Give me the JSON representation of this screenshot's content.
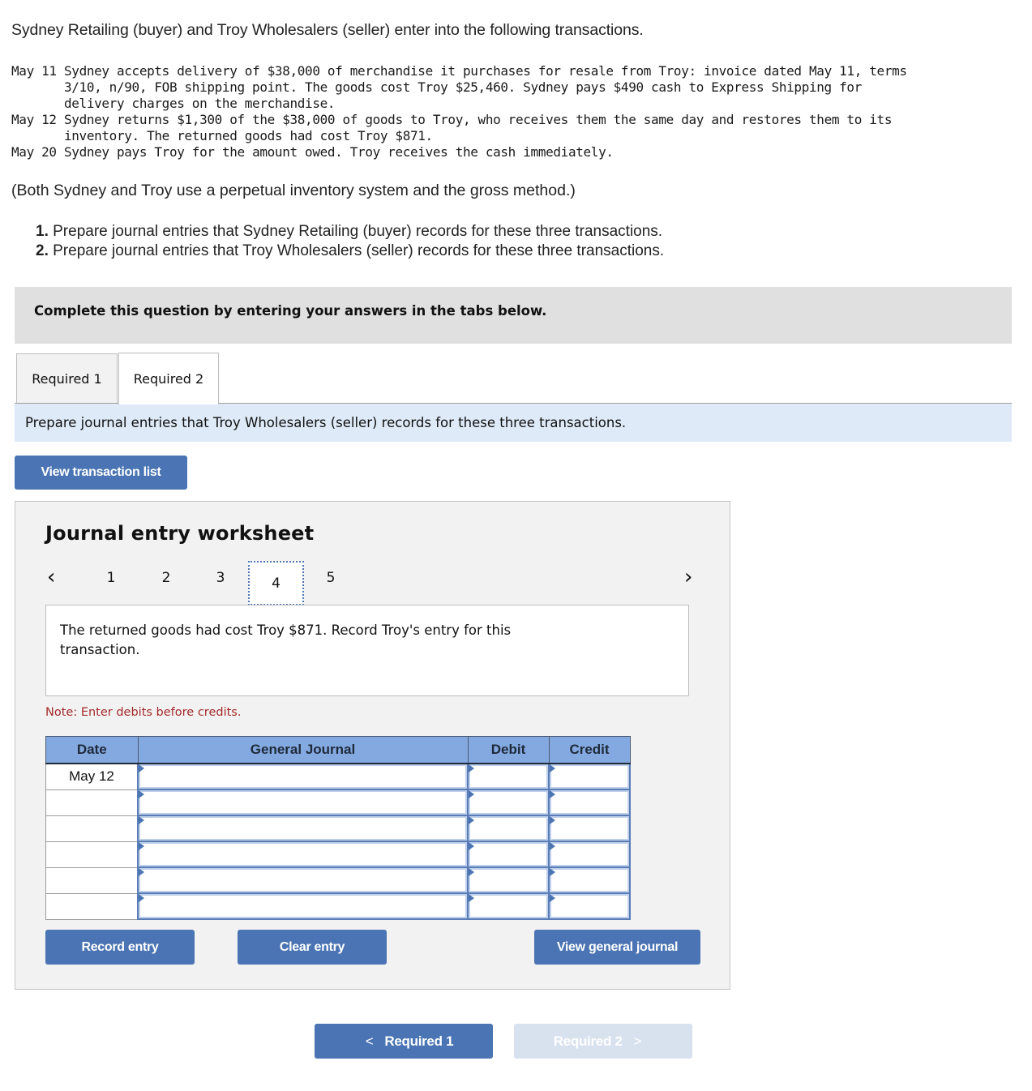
{
  "intro": "Sydney Retailing (buyer) and Troy Wholesalers (seller) enter into the following transactions.",
  "transactions": [
    {
      "date": "May 11",
      "lines": [
        "Sydney accepts delivery of $38,000 of merchandise it purchases for resale from Troy: invoice dated May 11, terms",
        "3/10, n/90, FOB shipping point. The goods cost Troy $25,460. Sydney pays $490 cash to Express Shipping for",
        "delivery charges on the merchandise."
      ]
    },
    {
      "date": "May 12",
      "lines": [
        "Sydney returns $1,300 of the $38,000 of goods to Troy, who receives them the same day and restores them to its",
        "inventory. The returned goods had cost Troy $871."
      ]
    },
    {
      "date": "May 20",
      "lines": [
        "Sydney pays Troy for the amount owed. Troy receives the cash immediately."
      ]
    }
  ],
  "assumption": "(Both Sydney and Troy use a perpetual inventory system and the gross method.)",
  "requirements": [
    {
      "num": "1.",
      "text": " Prepare journal entries that Sydney Retailing (buyer) records for these three transactions."
    },
    {
      "num": "2.",
      "text": " Prepare journal entries that Troy Wholesalers (seller) records for these three transactions."
    }
  ],
  "banner": "Complete this question by entering your answers in the tabs below.",
  "tabs": [
    {
      "label": "Required 1",
      "active": false
    },
    {
      "label": "Required 2",
      "active": true
    }
  ],
  "instruction": "Prepare journal entries that Troy Wholesalers (seller) records for these three transactions.",
  "view_transaction_list": "View transaction list",
  "worksheet": {
    "title": "Journal entry worksheet",
    "pages": [
      "1",
      "2",
      "3",
      "4",
      "5"
    ],
    "active_page": "4",
    "prev_icon": "chevron-left-icon",
    "next_icon": "chevron-right-icon",
    "description": "The returned goods had cost Troy $871. Record Troy's entry for this transaction.",
    "note": "Note: Enter debits before credits.",
    "columns": [
      "Date",
      "General Journal",
      "Debit",
      "Credit"
    ],
    "rows": [
      {
        "date": "May 12",
        "account": "",
        "debit": "",
        "credit": ""
      },
      {
        "date": "",
        "account": "",
        "debit": "",
        "credit": ""
      },
      {
        "date": "",
        "account": "",
        "debit": "",
        "credit": ""
      },
      {
        "date": "",
        "account": "",
        "debit": "",
        "credit": ""
      },
      {
        "date": "",
        "account": "",
        "debit": "",
        "credit": ""
      },
      {
        "date": "",
        "account": "",
        "debit": "",
        "credit": ""
      }
    ],
    "record_entry": "Record entry",
    "clear_entry": "Clear entry",
    "view_general_journal": "View general journal"
  },
  "footer_nav": {
    "prev_label": "Required 1",
    "next_label": "Required 2",
    "next_enabled": false
  },
  "colors": {
    "button_blue": "#4a74b3",
    "header_blue": "#84a9e0",
    "instruction_bg": "#deeaf7",
    "note_red": "#a52a2a",
    "disabled_button": "#d8e2ef"
  }
}
